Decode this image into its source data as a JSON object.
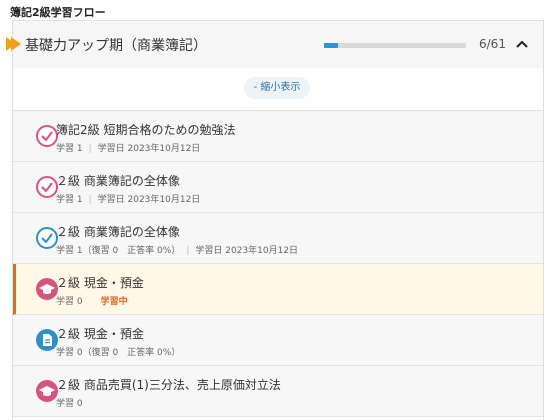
{
  "page": {
    "title": "簿記2級学習フロー"
  },
  "section": {
    "title": "基礎力アップ期（商業簿記）",
    "progress_text": "6/61",
    "progress_fraction": 0.098
  },
  "toggle": {
    "label": "- 縮小表示"
  },
  "items": [
    {
      "title": "簿記2級 短期合格のための勉強法",
      "meta_study": "学習 1",
      "meta_date": "学習日 2023年10月12日",
      "icon": "check-icon",
      "color": "#d4567f"
    },
    {
      "title": "２級 商業簿記の全体像",
      "meta_study": "学習 1",
      "meta_date": "学習日 2023年10月12日",
      "icon": "check-icon",
      "color": "#d4567f"
    },
    {
      "title": "２級 商業簿記の全体像",
      "meta_study": "学習 1（復習 0　正答率 0%）",
      "meta_date": "学習日 2023年10月12日",
      "icon": "check-icon",
      "color": "#2f8fc7"
    },
    {
      "title": "２級 現金・預金",
      "meta_study": "学習 0",
      "status": "学習中",
      "icon": "graduation-cap-icon",
      "color": "#d4567f"
    },
    {
      "title": "２級 現金・預金",
      "meta_study": "学習 0（復習 0　正答率 0%）",
      "icon": "document-icon",
      "color": "#2f8fc7"
    },
    {
      "title": "２級 商品売買(1)三分法、売上原価対立法",
      "meta_study": "学習 0",
      "icon": "graduation-cap-icon",
      "color": "#d4567f"
    }
  ],
  "colors": {
    "accent_orange": "#e8662a",
    "progress_blue": "#1f9bd1",
    "pink": "#d4567f",
    "blue": "#2f8fc7"
  }
}
